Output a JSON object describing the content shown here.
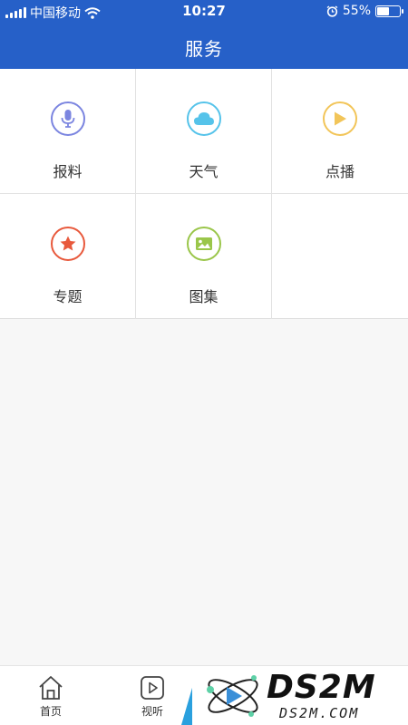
{
  "status_bar": {
    "carrier": "中国移动",
    "time": "10:27",
    "battery": "55%",
    "battery_level": 0.55
  },
  "header": {
    "title": "服务"
  },
  "services": [
    {
      "label": "报料",
      "icon": "microphone-icon",
      "color": "#7b85e0"
    },
    {
      "label": "天气",
      "icon": "cloud-icon",
      "color": "#55c3ea"
    },
    {
      "label": "点播",
      "icon": "play-icon",
      "color": "#f2c559"
    },
    {
      "label": "专题",
      "icon": "star-icon",
      "color": "#e8593c"
    },
    {
      "label": "图集",
      "icon": "image-icon",
      "color": "#9ac64a"
    }
  ],
  "tabbar": {
    "items": [
      {
        "label": "首页",
        "icon": "home-icon"
      },
      {
        "label": "视听",
        "icon": "video-play-icon"
      }
    ]
  },
  "watermark": {
    "logo": "DS2M",
    "site": "DS2M.COM"
  }
}
